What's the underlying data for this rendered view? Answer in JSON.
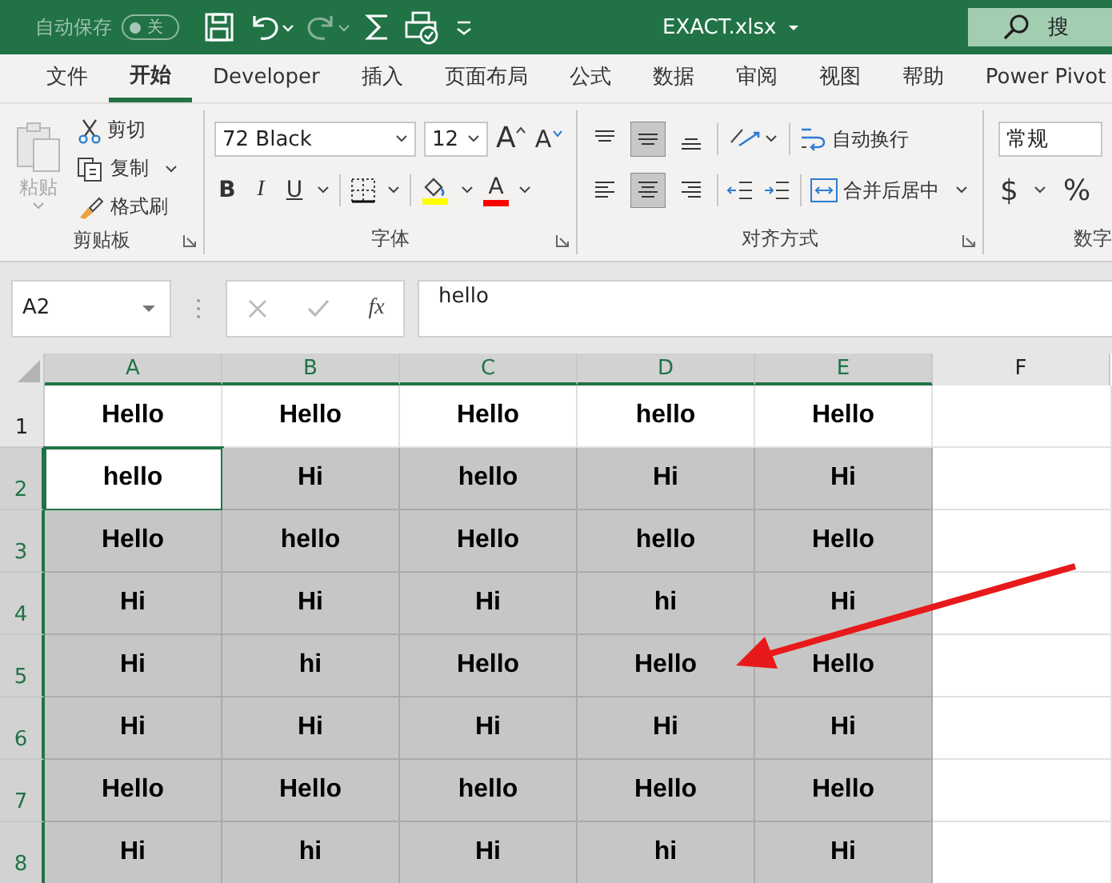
{
  "title_bar": {
    "autosave_label": "自动保存",
    "autosave": {
      "on": false,
      "label": "关"
    },
    "title": "EXACT.xlsx",
    "search": "搜"
  },
  "tabs": [
    {
      "label": "文件",
      "selected": false
    },
    {
      "label": "开始",
      "selected": true
    },
    {
      "label": "Developer",
      "selected": false
    },
    {
      "label": "插入",
      "selected": false
    },
    {
      "label": "页面布局",
      "selected": false
    },
    {
      "label": "公式",
      "selected": false
    },
    {
      "label": "数据",
      "selected": false
    },
    {
      "label": "审阅",
      "selected": false
    },
    {
      "label": "视图",
      "selected": false
    },
    {
      "label": "帮助",
      "selected": false
    },
    {
      "label": "Power Pivot",
      "selected": false
    }
  ],
  "ribbon": {
    "clipboard": {
      "paste": "粘贴",
      "cut": "剪切",
      "copy": "复制",
      "format_painter": "格式刷",
      "label": "剪贴板"
    },
    "font": {
      "family": "72 Black",
      "size": "12",
      "grow": "A",
      "shrink": "A",
      "bold": "B",
      "italic": "I",
      "underline": "U",
      "font_color": "A",
      "label": "字体"
    },
    "alignment": {
      "vertical": [
        {
          "kind": "top",
          "selected": false
        },
        {
          "kind": "middle",
          "selected": true
        },
        {
          "kind": "bottom",
          "selected": false
        }
      ],
      "horizontal": [
        {
          "kind": "left",
          "selected": false
        },
        {
          "kind": "center",
          "selected": true
        },
        {
          "kind": "right",
          "selected": false
        }
      ],
      "wrap": "自动换行",
      "merge": "合并后居中",
      "label": "对齐方式"
    },
    "number": {
      "format": "常规",
      "currency": "$",
      "percent": "%",
      "label": "数字"
    }
  },
  "formula_bar": {
    "name_box": "A2",
    "fx": "fx",
    "value": "hello"
  },
  "sheet": {
    "columns": [
      {
        "label": "A",
        "selected": true
      },
      {
        "label": "B",
        "selected": true
      },
      {
        "label": "C",
        "selected": true
      },
      {
        "label": "D",
        "selected": true
      },
      {
        "label": "E",
        "selected": true
      },
      {
        "label": "F",
        "selected": false
      }
    ],
    "rows": [
      {
        "header": "1",
        "selected": false,
        "cells": [
          {
            "text": "Hello",
            "selected": false
          },
          {
            "text": "Hello",
            "selected": false
          },
          {
            "text": "Hello",
            "selected": false
          },
          {
            "text": "hello",
            "selected": false
          },
          {
            "text": "Hello",
            "selected": false
          }
        ]
      },
      {
        "header": "2",
        "selected": true,
        "cells": [
          {
            "text": "hello",
            "selected": false
          },
          {
            "text": "Hi",
            "selected": true
          },
          {
            "text": "hello",
            "selected": true
          },
          {
            "text": "Hi",
            "selected": true
          },
          {
            "text": "Hi",
            "selected": true
          }
        ]
      },
      {
        "header": "3",
        "selected": true,
        "cells": [
          {
            "text": "Hello",
            "selected": true
          },
          {
            "text": "hello",
            "selected": true
          },
          {
            "text": "Hello",
            "selected": true
          },
          {
            "text": "hello",
            "selected": true
          },
          {
            "text": "Hello",
            "selected": true
          }
        ]
      },
      {
        "header": "4",
        "selected": true,
        "cells": [
          {
            "text": "Hi",
            "selected": true
          },
          {
            "text": "Hi",
            "selected": true
          },
          {
            "text": "Hi",
            "selected": true
          },
          {
            "text": "hi",
            "selected": true
          },
          {
            "text": "Hi",
            "selected": true
          }
        ]
      },
      {
        "header": "5",
        "selected": true,
        "cells": [
          {
            "text": "Hi",
            "selected": true
          },
          {
            "text": "hi",
            "selected": true
          },
          {
            "text": "Hello",
            "selected": true
          },
          {
            "text": "Hello",
            "selected": true
          },
          {
            "text": "Hello",
            "selected": true
          }
        ]
      },
      {
        "header": "6",
        "selected": true,
        "cells": [
          {
            "text": "Hi",
            "selected": true
          },
          {
            "text": "Hi",
            "selected": true
          },
          {
            "text": "Hi",
            "selected": true
          },
          {
            "text": "Hi",
            "selected": true
          },
          {
            "text": "Hi",
            "selected": true
          }
        ]
      },
      {
        "header": "7",
        "selected": true,
        "cells": [
          {
            "text": "Hello",
            "selected": true
          },
          {
            "text": "Hello",
            "selected": true
          },
          {
            "text": "hello",
            "selected": true
          },
          {
            "text": "Hello",
            "selected": true
          },
          {
            "text": "Hello",
            "selected": true
          }
        ]
      },
      {
        "header": "8",
        "selected": true,
        "cells": [
          {
            "text": "Hi",
            "selected": true
          },
          {
            "text": "hi",
            "selected": true
          },
          {
            "text": "Hi",
            "selected": true
          },
          {
            "text": "hi",
            "selected": true
          },
          {
            "text": "Hi",
            "selected": true
          }
        ]
      }
    ]
  }
}
